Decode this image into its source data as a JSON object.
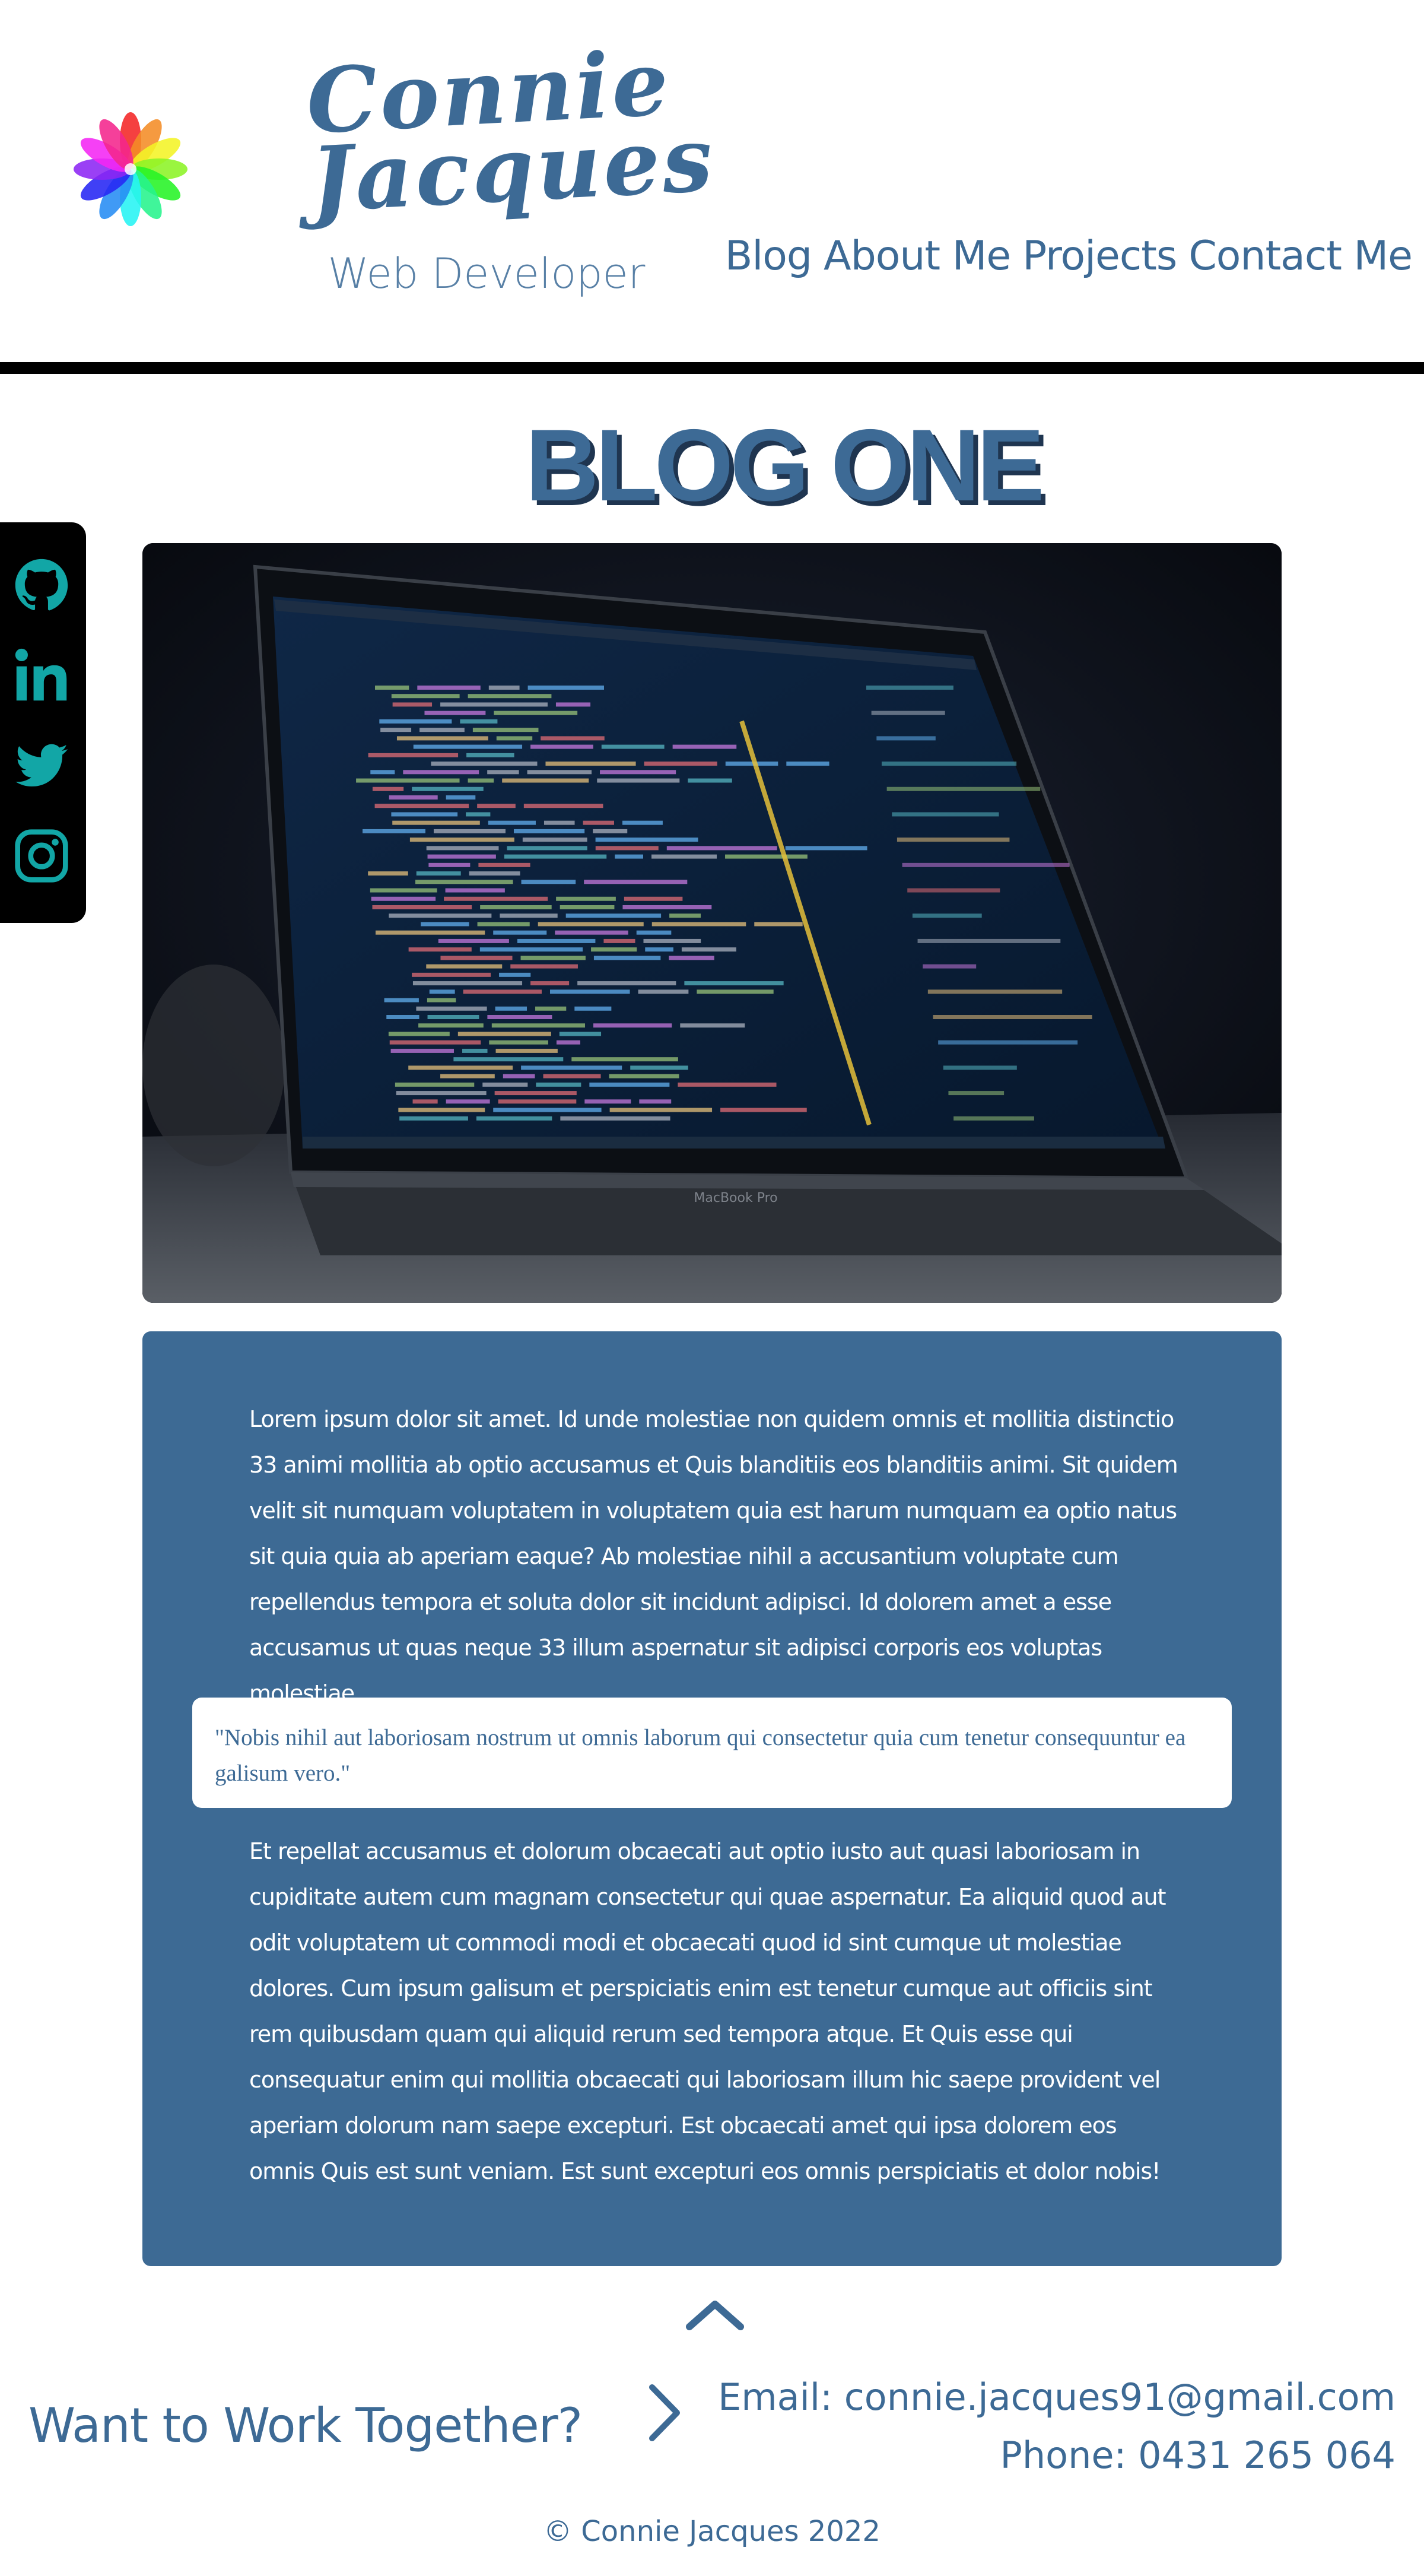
{
  "header": {
    "logo_icon": "rainbow-flower-icon",
    "brand_name": "Connie Jacques",
    "brand_role": "Web Developer",
    "nav": [
      "Blog",
      "About Me",
      "Projects",
      "Contact Me"
    ]
  },
  "page": {
    "title": "BLOG ONE"
  },
  "social": {
    "icons": [
      "github-icon",
      "linkedin-icon",
      "twitter-icon",
      "instagram-icon"
    ]
  },
  "hero": {
    "image": "laptop-with-code-editor",
    "device_label": "MacBook Pro"
  },
  "article": {
    "paragraph_1": "Lorem ipsum dolor sit amet. Id unde molestiae non quidem omnis et mollitia distinctio 33 animi mollitia ab optio accusamus et Quis blanditiis eos blanditiis animi. Sit quidem velit sit numquam voluptatem in voluptatem quia est harum numquam ea optio natus sit quia quia ab aperiam eaque? Ab molestiae nihil a accusantium voluptate cum repellendus tempora et soluta dolor sit incidunt adipisci. Id dolorem amet a esse accusamus ut quas neque 33 illum aspernatur sit adipisci corporis eos voluptas molestiae.",
    "quote": "\"Nobis nihil aut laboriosam nostrum ut omnis laborum qui consectetur quia cum tenetur consequuntur ea galisum vero.\"",
    "paragraph_2": "Et repellat accusamus et dolorum obcaecati aut optio iusto aut quasi laboriosam in cupiditate autem cum magnam consectetur qui quae aspernatur. Ea aliquid quod aut odit voluptatem ut commodi modi et obcaecati quod id sint cumque ut molestiae dolores. Cum ipsum galisum et perspiciatis enim est tenetur cumque aut officiis sint rem quibusdam quam qui aliquid rerum sed tempora atque. Et Quis esse qui consequatur enim qui mollitia obcaecati qui laboriosam illum hic saepe provident vel aperiam dolorum nam saepe excepturi. Est obcaecati amet qui ipsa dolorem eos omnis Quis est sunt veniam. Est sunt excepturi eos omnis perspiciatis et dolor nobis!"
  },
  "footer": {
    "scroll_top_icon": "chevron-up-icon",
    "cta": "Want to Work Together?",
    "cta_icon": "chevron-right-icon",
    "email": "Email: connie.jacques91@gmail.com",
    "phone": "Phone: 0431 265 064",
    "copyright": "© Connie Jacques 2022"
  },
  "colors": {
    "brand": "#3d6a95",
    "card": "#3d6a94",
    "header_rule": "#000000",
    "social_bg": "#000000",
    "social_icon": "#12a6a6"
  }
}
